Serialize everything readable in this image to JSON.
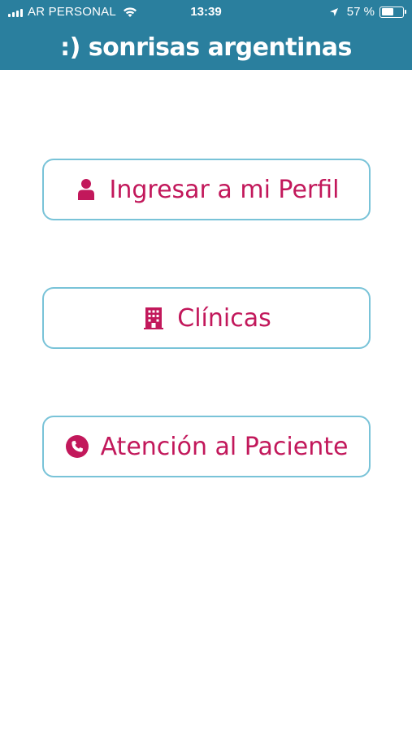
{
  "status_bar": {
    "carrier": "AR PERSONAL",
    "time": "13:39",
    "battery_percent": "57 %",
    "battery_level": 0.57,
    "icons": [
      "signal-icon",
      "wifi-icon",
      "location-icon",
      "battery-icon"
    ]
  },
  "header": {
    "brand": ":) sonrisas argentinas"
  },
  "menu": {
    "profile_label": "Ingresar a mi Perfil",
    "profile_icon": "person-icon",
    "clinics_label": "Clínicas",
    "clinics_icon": "building-icon",
    "patient_label": "Atención al Paciente",
    "patient_icon": "phone-icon"
  },
  "colors": {
    "header_bg": "#2a7f9e",
    "accent": "#c2185b",
    "button_border": "#79c3d8"
  }
}
